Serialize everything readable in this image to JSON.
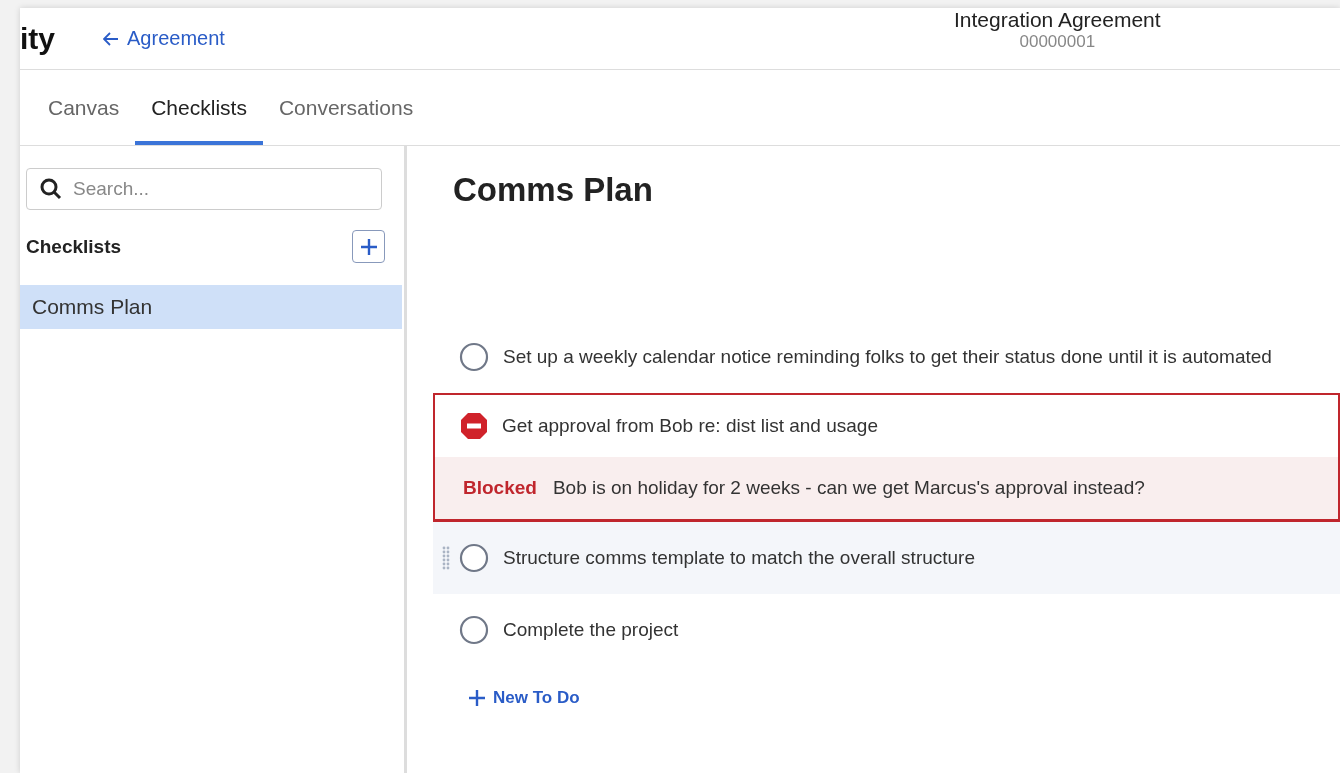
{
  "header": {
    "app_title_fragment": "ity",
    "back_link": "Agreement",
    "record_title": "Integration Agreement",
    "record_number": "00000001"
  },
  "tabs": [
    {
      "label": "Canvas",
      "selected": false
    },
    {
      "label": "Checklists",
      "selected": true
    },
    {
      "label": "Conversations",
      "selected": false
    }
  ],
  "sidebar": {
    "search": {
      "placeholder": "Search..."
    },
    "heading": "Checklists",
    "items": [
      {
        "label": "Comms Plan",
        "selected": true
      }
    ]
  },
  "checklist": {
    "title": "Comms Plan",
    "items": [
      {
        "kind": "todo",
        "label": "Set up a weekly calendar notice reminding folks to get their status done until it is automated",
        "hovered": false
      },
      {
        "kind": "blocked",
        "label": "Get approval from Bob re: dist list and usage",
        "status": "Blocked",
        "note": "Bob is on holiday for 2 weeks - can we get Marcus's approval instead?"
      },
      {
        "kind": "todo",
        "label": "Structure comms template to match the overall structure",
        "hovered": true
      },
      {
        "kind": "todo",
        "label": "Complete the project",
        "hovered": false
      }
    ],
    "add_button": "New To Do"
  }
}
